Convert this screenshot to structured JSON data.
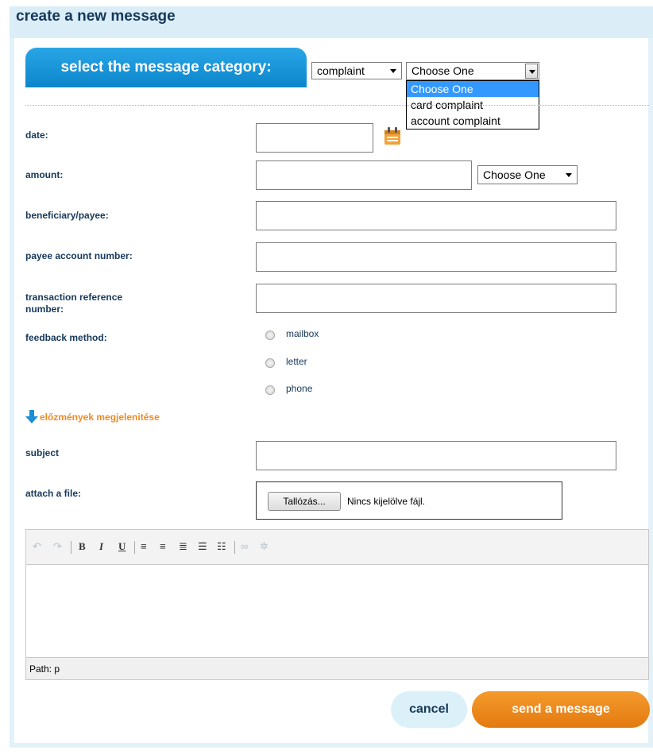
{
  "page": {
    "title": "create a new message"
  },
  "category": {
    "tab_label": "select the message category:",
    "main_select_value": "complaint",
    "sub_select_value": "Choose One",
    "sub_options": [
      "Choose One",
      "card complaint",
      "account complaint"
    ]
  },
  "form": {
    "date_label": "date:",
    "amount_label": "amount:",
    "currency_select_value": "Choose One",
    "beneficiary_label": "beneficiary/payee:",
    "payee_account_label": "payee account number:",
    "transaction_ref_label_line1": "transaction reference",
    "transaction_ref_label_line2": "number:",
    "feedback_label": "feedback method:",
    "feedback_options": [
      "mailbox",
      "letter",
      "phone"
    ],
    "history_link": "előzmények megjelenitése",
    "subject_label": "subject",
    "attach_label": "attach a file:",
    "browse_button": "Tallózás...",
    "file_status": "Nincs kijelölve fájl."
  },
  "editor": {
    "path_text": "Path: p"
  },
  "actions": {
    "cancel": "cancel",
    "send": "send a message"
  },
  "colors": {
    "accent_blue": "#0b86cc",
    "accent_orange": "#e37a10",
    "text_navy": "#17385a"
  }
}
